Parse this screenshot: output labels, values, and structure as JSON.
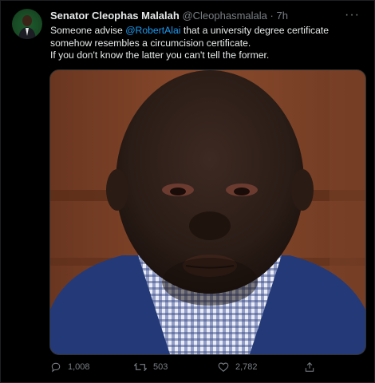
{
  "author": {
    "name": "Senator Cleophas Malalah",
    "handle": "@Cleophasmalala",
    "separator": "·",
    "time": "7h"
  },
  "more_label": "···",
  "tweet": {
    "part1": "Someone advise ",
    "mention": "@RobertAlai",
    "part2": " that a university degree certificate somehow resembles a circumcision certificate.",
    "line2": "If you don't know the latter you can't tell the former."
  },
  "actions": {
    "replies": "1,008",
    "retweets": "503",
    "likes": "2,782"
  },
  "icons": {
    "reply": "reply-icon",
    "retweet": "retweet-icon",
    "like": "heart-icon",
    "share": "share-icon",
    "more": "more-icon"
  },
  "colors": {
    "background": "#000000",
    "text": "#e7e9ea",
    "muted": "#7a7f85",
    "link": "#1d9bf0"
  }
}
